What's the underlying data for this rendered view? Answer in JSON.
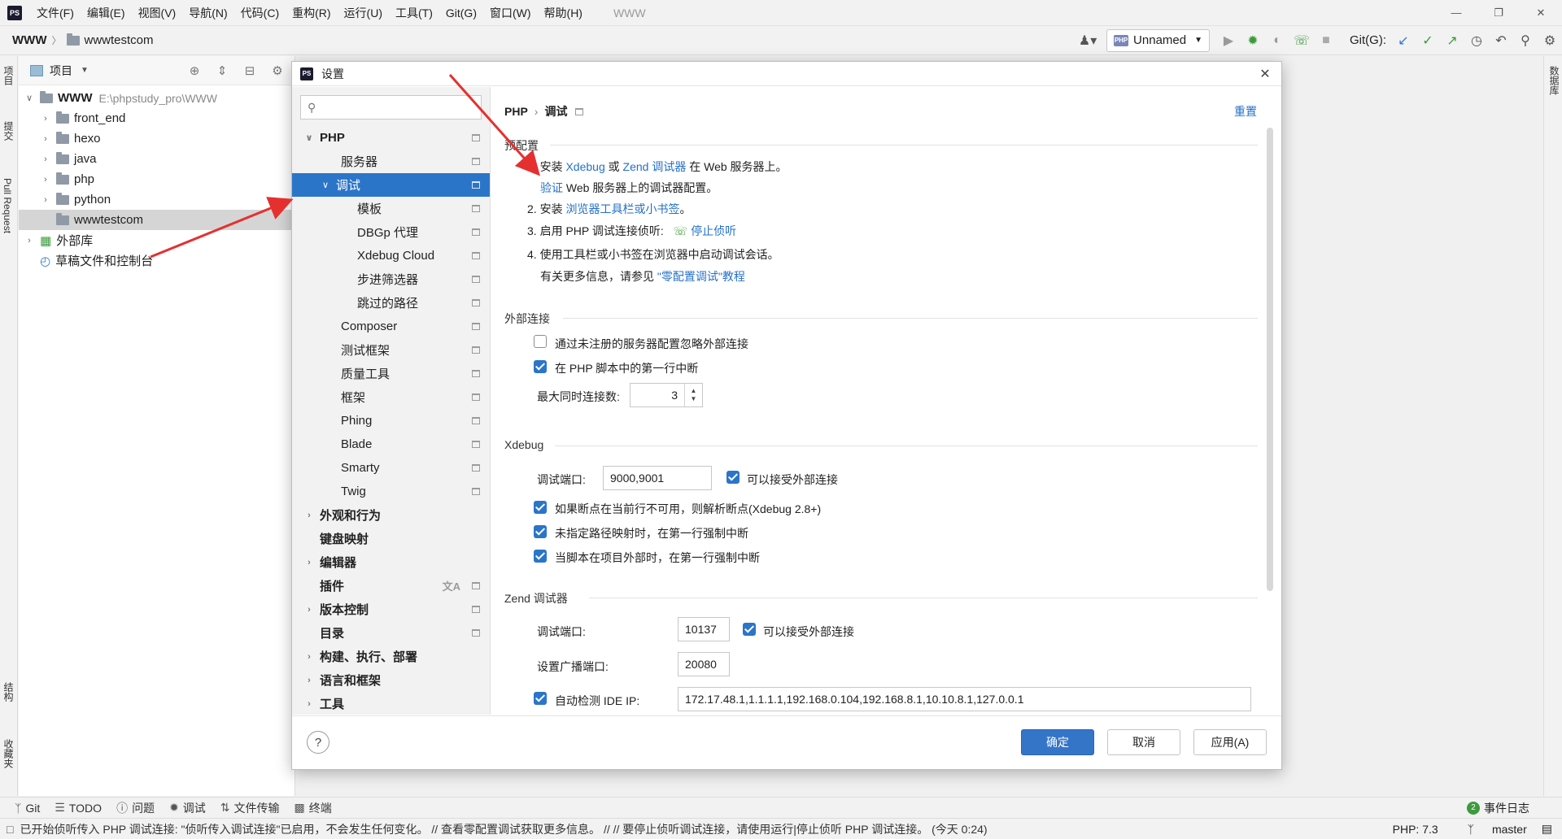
{
  "menubar": {
    "app_logo": "PS",
    "items": [
      "文件(F)",
      "编辑(E)",
      "视图(V)",
      "导航(N)",
      "代码(C)",
      "重构(R)",
      "运行(U)",
      "工具(T)",
      "Git(G)",
      "窗口(W)",
      "帮助(H)"
    ],
    "project": "WWW"
  },
  "navbar": {
    "root": "WWW",
    "leaf": "wwwtestcom",
    "run_config": "Unnamed",
    "git_label": "Git(G):"
  },
  "left_strip": {
    "project": "项目",
    "commit": "提交",
    "pull_request": "Pull Request",
    "structure": "结构",
    "favorites": "收藏夹"
  },
  "right_strip": {
    "database": "数据库"
  },
  "project_panel": {
    "title": "项目",
    "root_name": "WWW",
    "root_path": "E:\\phpstudy_pro\\WWW",
    "folders": [
      "front_end",
      "hexo",
      "java",
      "php",
      "python"
    ],
    "selected_folder": "wwwtestcom",
    "external_libs": "外部库",
    "scratches": "草稿文件和控制台"
  },
  "dialog": {
    "title": "设置",
    "search_placeholder": "",
    "crumb_root": "PHP",
    "crumb_leaf": "调试",
    "reset": "重置",
    "tree": [
      {
        "label": "PHP",
        "level": 0,
        "bold": true,
        "expanded": true
      },
      {
        "label": "服务器",
        "level": 1
      },
      {
        "label": "调试",
        "level": 1,
        "selected": true,
        "expanded": true
      },
      {
        "label": "模板",
        "level": 2
      },
      {
        "label": "DBGp 代理",
        "level": 2
      },
      {
        "label": "Xdebug Cloud",
        "level": 2
      },
      {
        "label": "步进筛选器",
        "level": 2
      },
      {
        "label": "跳过的路径",
        "level": 2
      },
      {
        "label": "Composer",
        "level": 1
      },
      {
        "label": "测试框架",
        "level": 1
      },
      {
        "label": "质量工具",
        "level": 1
      },
      {
        "label": "框架",
        "level": 1
      },
      {
        "label": "Phing",
        "level": 1
      },
      {
        "label": "Blade",
        "level": 1
      },
      {
        "label": "Smarty",
        "level": 1
      },
      {
        "label": "Twig",
        "level": 1
      },
      {
        "label": "外观和行为",
        "level": 0,
        "bold": true,
        "collapsed": true,
        "noicon": true
      },
      {
        "label": "键盘映射",
        "level": 0,
        "bold": true,
        "noicon": true
      },
      {
        "label": "编辑器",
        "level": 0,
        "bold": true,
        "collapsed": true,
        "noicon": true
      },
      {
        "label": "插件",
        "level": 0,
        "bold": true,
        "translate": true
      },
      {
        "label": "版本控制",
        "level": 0,
        "bold": true,
        "collapsed": true
      },
      {
        "label": "目录",
        "level": 0,
        "bold": true
      },
      {
        "label": "构建、执行、部署",
        "level": 0,
        "bold": true,
        "collapsed": true,
        "noicon": true
      },
      {
        "label": "语言和框架",
        "level": 0,
        "bold": true,
        "collapsed": true,
        "noicon": true
      },
      {
        "label": "工具",
        "level": 0,
        "bold": true,
        "collapsed": true,
        "noicon": true
      }
    ],
    "preconfig": {
      "title": "预配置",
      "step1_a": "1. 安装 ",
      "step1_xdebug": "Xdebug",
      "step1_or": " 或 ",
      "step1_zend": "Zend 调试器",
      "step1_b": " 在 Web 服务器上。",
      "verify_link": "验证",
      "verify_rest": " Web 服务器上的调试器配置。",
      "step2_a": "2. 安装 ",
      "step2_link": "浏览器工具栏或小书签",
      "step2_b": "。",
      "step3_a": "3. 启用 PHP 调试连接侦听:",
      "step3_link": "停止侦听",
      "step4": "4. 使用工具栏或小书签在浏览器中启动调试会话。",
      "more_a": "有关更多信息，请参见 ",
      "more_link": "\"零配置调试\"教程"
    },
    "external": {
      "title": "外部连接",
      "ignore_unregistered": "通过未注册的服务器配置忽略外部连接",
      "ignore_unregistered_checked": false,
      "break_first_line": "在 PHP 脚本中的第一行中断",
      "break_first_line_checked": true,
      "max_conn_label": "最大同时连接数:",
      "max_conn_value": "3"
    },
    "xdebug": {
      "title": "Xdebug",
      "port_label": "调试端口:",
      "port_value": "9000,9001",
      "accept_external": "可以接受外部连接",
      "resolve_breakpoint": "如果断点在当前行不可用，则解析断点(Xdebug 2.8+)",
      "force_break_no_mapping": "未指定路径映射时，在第一行强制中断",
      "force_break_outside": "当脚本在项目外部时，在第一行强制中断"
    },
    "zend": {
      "title": "Zend 调试器",
      "port_label": "调试端口:",
      "port_value": "10137",
      "accept_external": "可以接受外部连接",
      "broadcast_label": "设置广播端口:",
      "broadcast_value": "20080",
      "auto_detect_label": "自动检测 IDE IP:",
      "ide_ip_value": "172.17.48.1,1.1.1.1,192.168.0.104,192.168.8.1,10.10.8.1,127.0.0.1"
    },
    "footer": {
      "help": "?",
      "ok": "确定",
      "cancel": "取消",
      "apply": "应用(A)"
    }
  },
  "bottom_tools": {
    "items": [
      "Git",
      "TODO",
      "问题",
      "调试",
      "文件传输",
      "终端"
    ],
    "event_count": "2",
    "event_log": "事件日志"
  },
  "status": {
    "message": "已开始侦听传入 PHP 调试连接: \"侦听传入调试连接\"已启用，不会发生任何变化。 // 查看零配置调试获取更多信息。 // // 要停止侦听调试连接，请使用运行|停止侦听 PHP 调试连接。 (今天 0:24)",
    "php_version": "PHP: 7.3",
    "branch": "master"
  },
  "colors": {
    "selection": "#2b75c9",
    "link": "#2470c8",
    "arrow": "#e53030"
  }
}
